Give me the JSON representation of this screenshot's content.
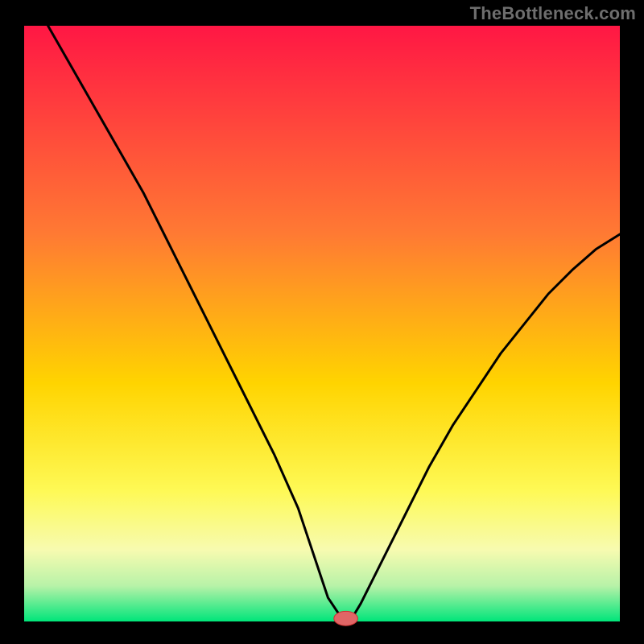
{
  "watermark": "TheBottleneck.com",
  "colors": {
    "accent": "#ff0033",
    "mid": "#ffd400",
    "good": "#00e57a",
    "curve": "#000000",
    "marker_fill": "#e06666",
    "marker_stroke": "#cc3333",
    "frame_bg": "#000000"
  },
  "chart_data": {
    "type": "line",
    "title": "",
    "xlabel": "",
    "ylabel": "",
    "xlim": [
      0,
      100
    ],
    "ylim": [
      0,
      100
    ],
    "axes_visible": false,
    "grid": false,
    "legend": false,
    "background_gradient": {
      "stops": [
        {
          "offset": 0.0,
          "color": "#ff1744"
        },
        {
          "offset": 0.35,
          "color": "#ff7a33"
        },
        {
          "offset": 0.6,
          "color": "#ffd400"
        },
        {
          "offset": 0.78,
          "color": "#fef955"
        },
        {
          "offset": 0.88,
          "color": "#f7fbb0"
        },
        {
          "offset": 0.94,
          "color": "#b8f2a8"
        },
        {
          "offset": 1.0,
          "color": "#00e57a"
        }
      ]
    },
    "series": [
      {
        "name": "bottleneck-curve",
        "x": [
          4,
          8,
          12,
          16,
          20,
          23,
          26,
          30,
          34,
          38,
          42,
          46,
          49,
          51,
          53,
          55,
          56.5,
          60,
          64,
          68,
          72,
          76,
          80,
          84,
          88,
          92,
          96,
          100
        ],
        "y": [
          100,
          93,
          86,
          79,
          72,
          66,
          60,
          52,
          44,
          36,
          28,
          19,
          10,
          4,
          1,
          0.5,
          3,
          10,
          18,
          26,
          33,
          39,
          45,
          50,
          55,
          59,
          62.5,
          65
        ]
      }
    ],
    "marker": {
      "x": 54,
      "y": 0.5,
      "rx": 2.0,
      "ry": 1.2
    }
  }
}
